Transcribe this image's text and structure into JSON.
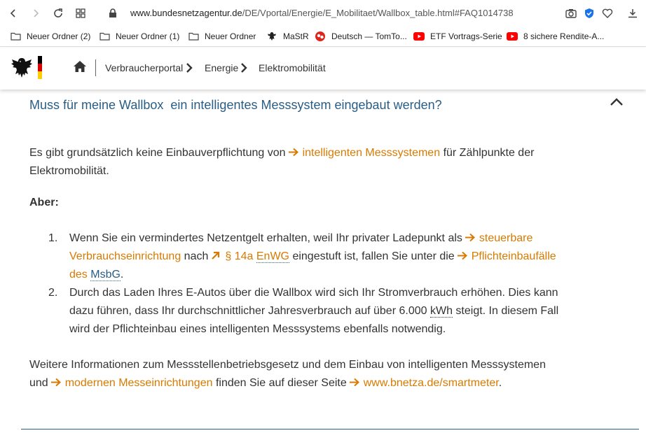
{
  "browser": {
    "url_host": "www.bundesnetzagentur.de",
    "url_path": "/DE/Vportal/Energie/E_Mobilitaet/Wallbox_table.html#FAQ1014738"
  },
  "bookmarks": [
    {
      "label": "Neuer Ordner (2)",
      "icon": "folder-icon"
    },
    {
      "label": "Neuer Ordner (1)",
      "icon": "folder-icon"
    },
    {
      "label": "Neuer Ordner",
      "icon": "folder-icon"
    },
    {
      "label": "MaStR",
      "icon": "eagle-icon"
    },
    {
      "label": "Deutsch — TomTo...",
      "icon": "tomtom-icon"
    },
    {
      "label": "ETF Vortrags-Serie",
      "icon": "youtube-icon"
    },
    {
      "label": "8 sichere Rendite-A...",
      "icon": "youtube-icon"
    }
  ],
  "breadcrumb": [
    "Verbraucherportal",
    "Energie",
    "Elektromobilität"
  ],
  "faq": {
    "title": "Muss für meine Wallbox  ein intelligentes Messsystem eingebaut werden?",
    "p1_a": "Es gibt grundsätzlich keine Einbauverpflichtung von",
    "p1_link": "intelligenten Messsystemen",
    "p1_b": "für Zählpunkte der",
    "p1_c": "Elektromobilität.",
    "aber": "Aber:",
    "items": [
      {
        "num": "1.",
        "a": "Wenn Sie ein vermindertes Netzentgelt erhalten, weil Ihr privater Ladepunkt als",
        "link1a": "steuerbare",
        "link1b": "Verbrauchseinrichtung",
        "b": "nach",
        "link2a": "§ 14a",
        "link2b": "EnWG",
        "c": "eingestuft ist, fallen Sie unter die",
        "link3a": "Pflichteinbaufälle",
        "link3b": "des",
        "link3c": "MsbG",
        "d": "."
      },
      {
        "num": "2.",
        "l1": "Durch das Laden Ihres E-Autos über die Wallbox wird sich Ihr Stromverbrauch erhöhen. Dies kann",
        "l2a": "dazu führen, dass Ihr durchschnittlicher Jahresverbrauch auf über 6.000",
        "l2abbr": "kWh",
        "l2b": "steigt. In diesem Fall",
        "l3": "wird der Pflichteinbau eines intelligenten Messsystems ebenfalls notwendig."
      }
    ],
    "p3_l1": "Weitere Informationen zum Messstellenbetriebsgesetz und dem Einbau von intelligenten Messsystemen",
    "p3_a": "und",
    "p3_link1": "modernen Messeinrichtungen",
    "p3_b": "finden Sie auf dieser Seite",
    "p3_link2": "www.bnetza.de/smartmeter",
    "p3_c": "."
  },
  "colors": {
    "link": "#d97a00",
    "title": "#2a5d84"
  }
}
